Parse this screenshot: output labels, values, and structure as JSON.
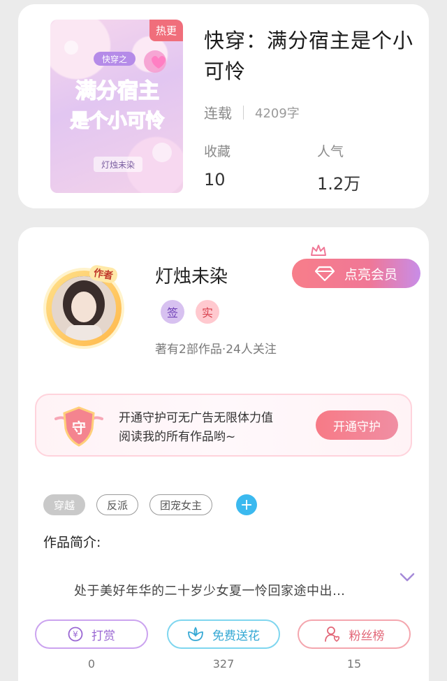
{
  "book": {
    "hot_badge": "热更",
    "title": "快穿：满分宿主是个小可怜",
    "status": "连载",
    "word_count": "4209字",
    "favorites_label": "收藏",
    "favorites_value": "10",
    "popularity_label": "人气",
    "popularity_value": "1.2万",
    "cover": {
      "tag": "快穿之",
      "line1": "满分宿主",
      "line2": "是个小可怜",
      "author": "灯烛未染"
    }
  },
  "author": {
    "avatar_tag": "作者",
    "name": "灯烛未染",
    "badges": [
      "签",
      "实"
    ],
    "meta": "著有2部作品·24人关注",
    "vip_button": "点亮会员"
  },
  "guard": {
    "shield_char": "守",
    "line1": "开通守护可无广告无限体力值",
    "line2": "阅读我的所有作品哟~",
    "button": "开通守护"
  },
  "tags": [
    "穿越",
    "反派",
    "团宠女主"
  ],
  "tag_add": "+",
  "intro": {
    "label": "作品简介:",
    "text": "处于美好年华的二十岁少女夏一怜回家途中出…"
  },
  "actions": [
    {
      "label": "打赏",
      "count": "0",
      "icon": "yuan-coin-icon"
    },
    {
      "label": "免费送花",
      "count": "327",
      "icon": "flower-icon"
    },
    {
      "label": "粉丝榜",
      "count": "15",
      "icon": "fans-user-icon"
    }
  ],
  "colors": {
    "hot": "#f06e7b",
    "vip_gradient_start": "#f77e8a",
    "vip_gradient_end": "#c88de8",
    "tag_add": "#3bb9ef",
    "reward": "#9a67d3",
    "flower": "#35a8d4",
    "fans": "#e26677"
  }
}
